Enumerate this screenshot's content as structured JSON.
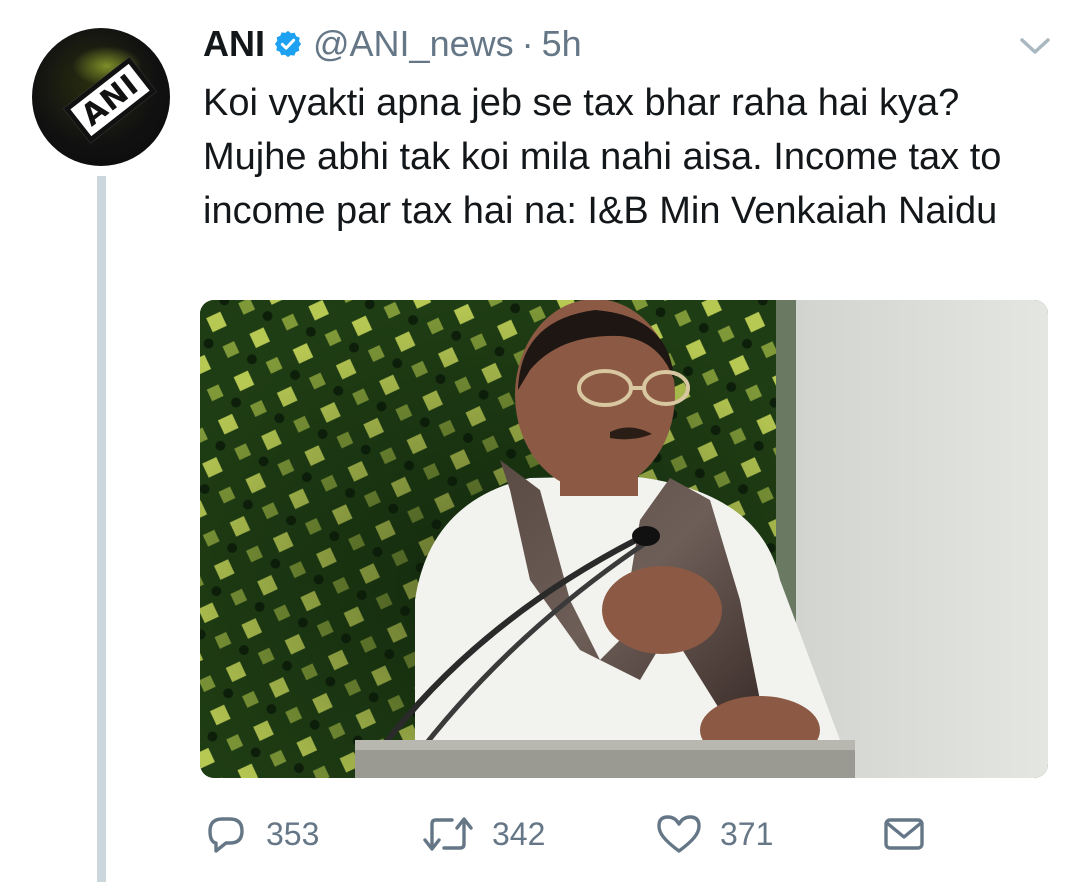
{
  "tweet": {
    "author_name": "ANI",
    "handle": "@ANI_news",
    "separator": "·",
    "time": "5h",
    "avatar_text": "ANI",
    "text": "Koi vyakti apna jeb se tax bhar raha hai kya? Mujhe abhi tak koi mila nahi aisa. Income tax to income par tax hai na: I&B Min Venkaiah Naidu"
  },
  "actions": {
    "reply_count": "353",
    "retweet_count": "342",
    "like_count": "371"
  },
  "icons": {
    "verified": "verified-badge-icon",
    "caret": "chevron-down-icon",
    "reply": "reply-icon",
    "retweet": "retweet-icon",
    "like": "heart-icon",
    "dm": "envelope-icon"
  },
  "colors": {
    "verified_blue": "#1da1f2",
    "muted_text": "#657786",
    "thread_line": "#ccd6dd"
  }
}
